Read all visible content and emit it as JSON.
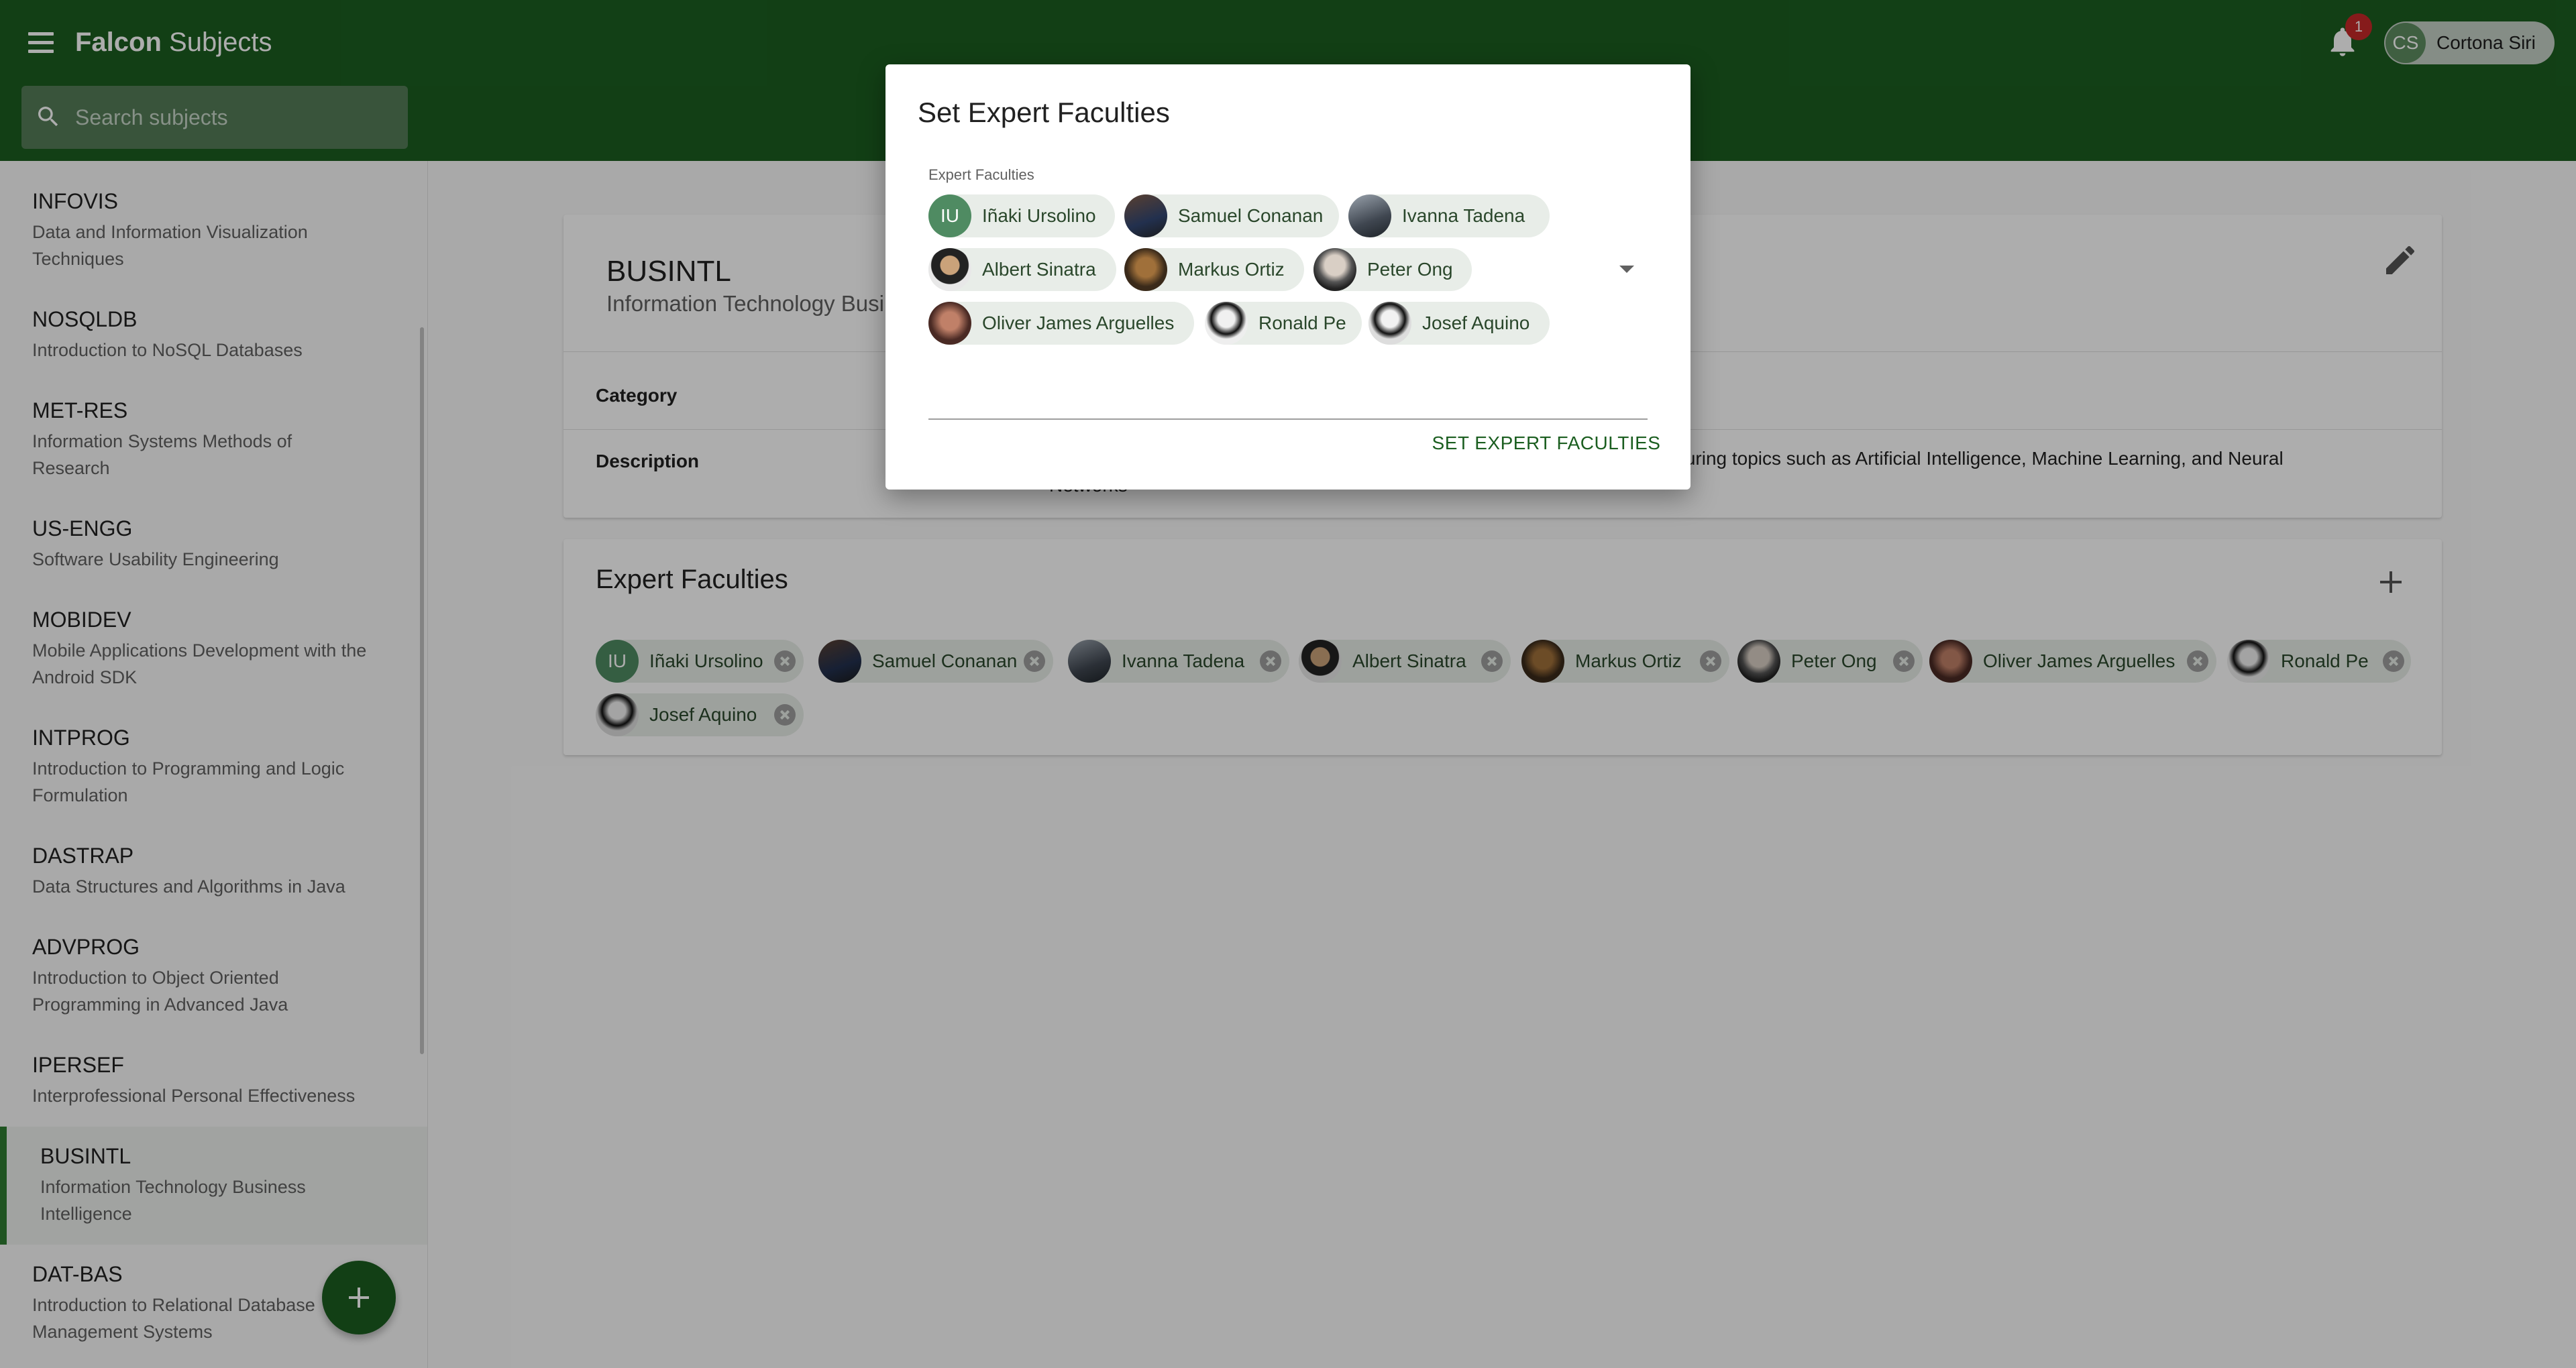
{
  "app": {
    "title_bold": "Falcon",
    "title_rest": " Subjects"
  },
  "search": {
    "placeholder": "Search subjects"
  },
  "notifications": {
    "count": "1"
  },
  "user": {
    "initials": "CS",
    "name": "Cortona Siri"
  },
  "sidebar": {
    "items": [
      {
        "code": "INFOVIS",
        "desc": "Data and Information Visualization Techniques"
      },
      {
        "code": "NOSQLDB",
        "desc": "Introduction to NoSQL Databases"
      },
      {
        "code": "MET-RES",
        "desc": "Information Systems Methods of Research"
      },
      {
        "code": "US-ENGG",
        "desc": "Software Usability Engineering"
      },
      {
        "code": "MOBIDEV",
        "desc": "Mobile Applications Development with the Android SDK"
      },
      {
        "code": "INTPROG",
        "desc": "Introduction to Programming and Logic Formulation"
      },
      {
        "code": "DASTRAP",
        "desc": "Data Structures and Algorithms in Java"
      },
      {
        "code": "ADVPROG",
        "desc": "Introduction to Object Oriented Programming in Advanced Java"
      },
      {
        "code": "IPERSEF",
        "desc": "Interprofessional Personal Effectiveness"
      },
      {
        "code": "BUSINTL",
        "desc": "Information Technology Business Intelligence",
        "active": true
      },
      {
        "code": "DAT-BAS",
        "desc": "Introduction to Relational Database Management Systems"
      }
    ]
  },
  "subject": {
    "code": "BUSINTL",
    "name": "Information Technology Busin",
    "category_label": "Category",
    "description_label": "Description",
    "description_visible": "echnology, featuring topics such as Artificial Intelligence, Machine Learning, and Neural",
    "description_wrap": "Networks"
  },
  "expert_faculties": {
    "title": "Expert Faculties",
    "chips": [
      {
        "name": "Iñaki Ursolino",
        "initials": "IU"
      },
      {
        "name": "Samuel Conanan"
      },
      {
        "name": "Ivanna Tadena"
      },
      {
        "name": "Albert Sinatra"
      },
      {
        "name": "Markus Ortiz"
      },
      {
        "name": "Peter Ong"
      },
      {
        "name": "Oliver James Arguelles"
      },
      {
        "name": "Ronald Pe"
      },
      {
        "name": "Josef Aquino"
      }
    ]
  },
  "dialog": {
    "title": "Set Expert Faculties",
    "field_label": "Expert Faculties",
    "action_label": "SET EXPERT FACULTIES",
    "chips": [
      {
        "name": "Iñaki Ursolino",
        "initials": "IU"
      },
      {
        "name": "Samuel Conanan"
      },
      {
        "name": "Ivanna Tadena"
      },
      {
        "name": "Albert Sinatra"
      },
      {
        "name": "Markus Ortiz"
      },
      {
        "name": "Peter Ong"
      },
      {
        "name": "Oliver James Arguelles"
      },
      {
        "name": "Ronald Pe"
      },
      {
        "name": "Josef Aquino"
      }
    ]
  },
  "colors": {
    "primary": "#1b5e20",
    "accent": "#2e7d32",
    "badge": "#c62828"
  }
}
